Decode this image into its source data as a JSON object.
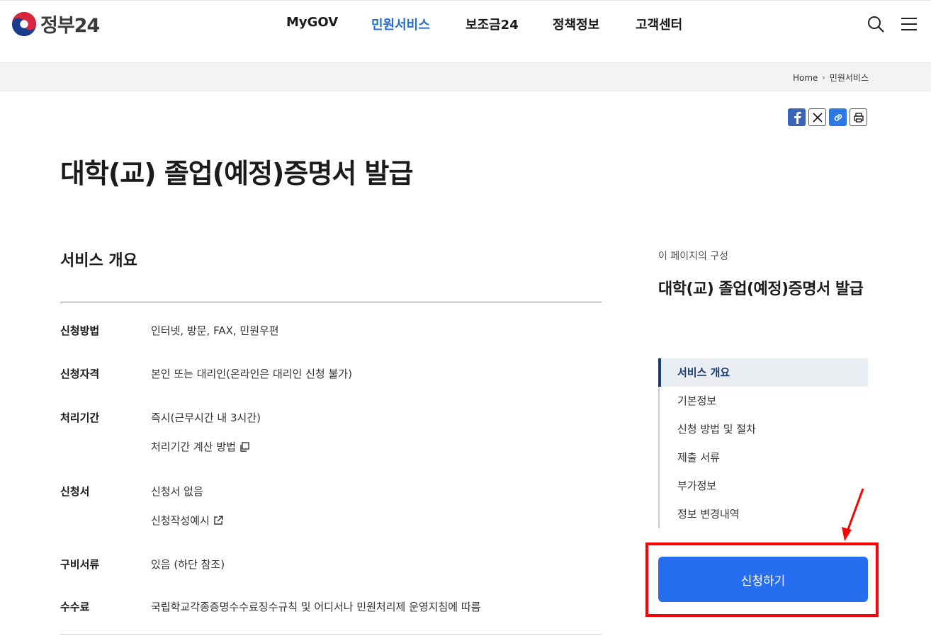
{
  "header": {
    "logo_text": "정부24",
    "nav": [
      "MyGOV",
      "민원서비스",
      "보조금24",
      "정책정보",
      "고객센터"
    ],
    "active_nav": "민원서비스",
    "icons": [
      "search-icon",
      "menu-icon"
    ]
  },
  "breadcrumb": {
    "home": "Home",
    "current": "민원서비스"
  },
  "share_icons": [
    "facebook-icon",
    "x-icon",
    "link-icon",
    "print-icon"
  ],
  "page_title": "대학(교) 졸업(예정)증명서 발급",
  "overview": {
    "title": "서비스 개요",
    "rows": [
      {
        "label": "신청방법",
        "value": "인터넷, 방문, FAX, 민원우편"
      },
      {
        "label": "신청자격",
        "value": "본인 또는 대리인(온라인은 대리인 신청 불가)"
      },
      {
        "label": "처리기간",
        "value": "즉시(근무시간 내 3시간)",
        "link": "처리기간 계산 방법"
      },
      {
        "label": "신청서",
        "value": "신청서 없음",
        "link": "신청작성예시"
      },
      {
        "label": "구비서류",
        "value": "있음 (하단 참조)"
      },
      {
        "label": "수수료",
        "value": "국립학교각종증명수수료징수규칙 및 어디서나 민원처리제 운영지침에 따름"
      }
    ]
  },
  "side": {
    "caption": "이 페이지의 구성",
    "title": "대학(교) 졸업(예정)증명서 발급",
    "items": [
      "서비스 개요",
      "기본정보",
      "신청 방법 및 절차",
      "제출 서류",
      "부가정보",
      "정보 변경내역"
    ],
    "active_item": "서비스 개요",
    "apply_label": "신청하기"
  },
  "colors": {
    "accent": "#256ef0",
    "active_nav": "#1f6fd8",
    "highlight": "#ff0000"
  }
}
